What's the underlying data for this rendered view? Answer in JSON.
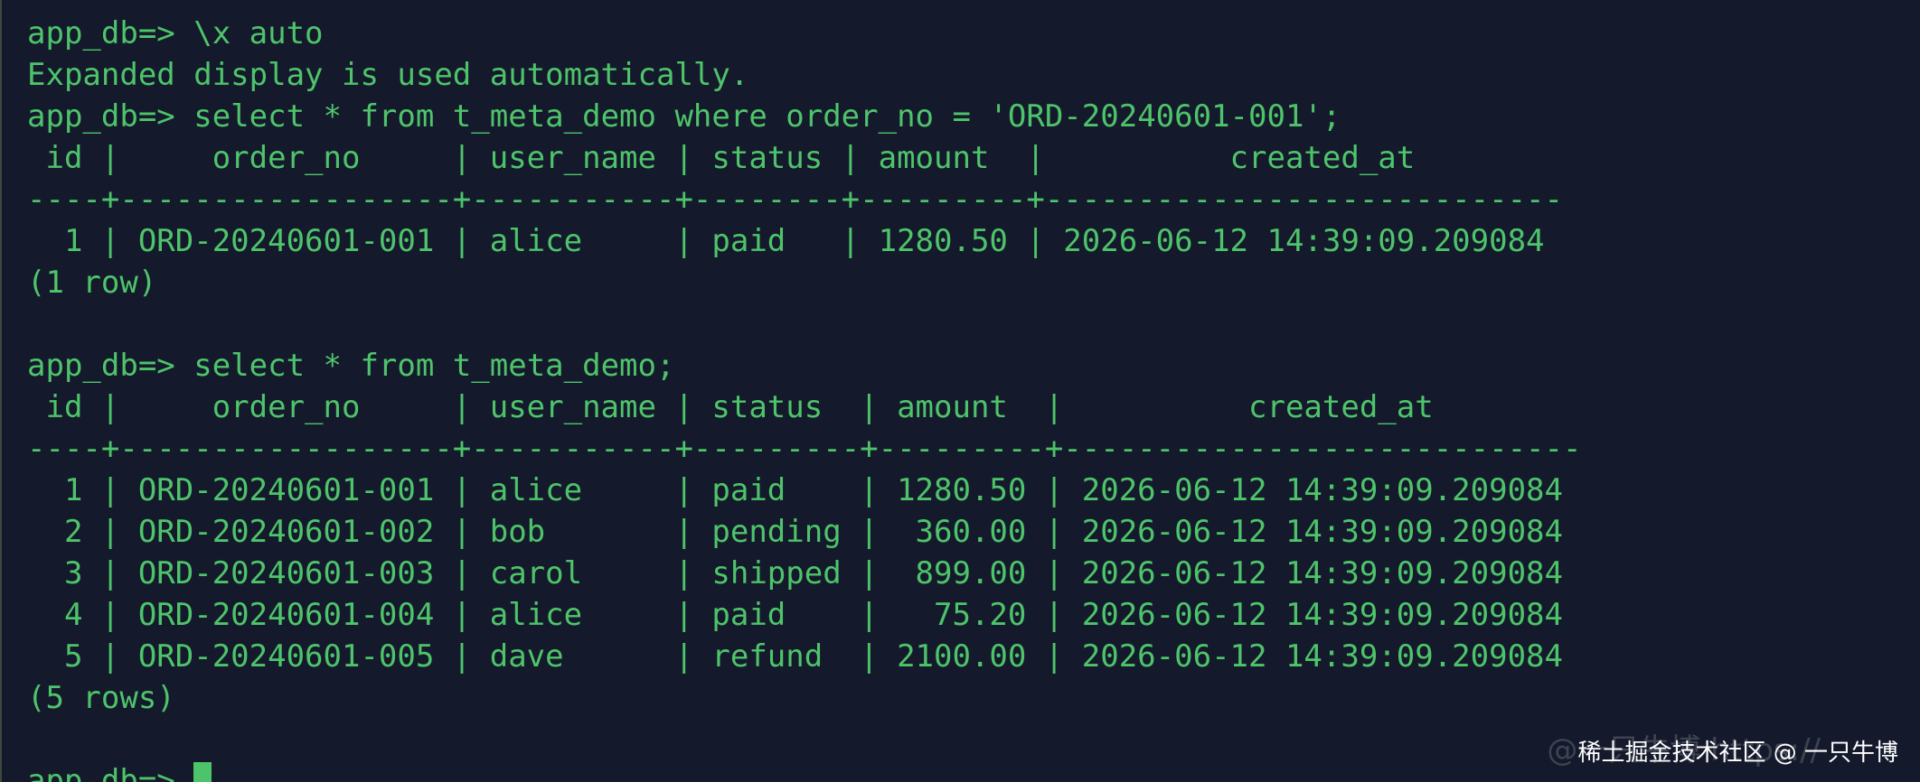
{
  "terminal": {
    "prompt": "app_db=> ",
    "lines": [
      {
        "kind": "input",
        "prompt": "app_db=> ",
        "text": "\\x auto"
      },
      {
        "kind": "output",
        "text": "Expanded display is used automatically."
      },
      {
        "kind": "input",
        "prompt": "app_db=> ",
        "text": "select * from t_meta_demo where order_no = 'ORD-20240601-001';"
      },
      {
        "kind": "table-header",
        "text": " id |     order_no     | user_name | status | amount  |          created_at"
      },
      {
        "kind": "table-separator",
        "text": "----+------------------+-----------+--------+---------+----------------------------"
      },
      {
        "kind": "table-row",
        "text": "  1 | ORD-20240601-001 | alice     | paid   | 1280.50 | 2026-06-12 14:39:09.209084"
      },
      {
        "kind": "output",
        "text": "(1 row)"
      },
      {
        "kind": "blank",
        "text": ""
      },
      {
        "kind": "input",
        "prompt": "app_db=> ",
        "text": "select * from t_meta_demo;"
      },
      {
        "kind": "table-header",
        "text": " id |     order_no     | user_name | status  | amount  |          created_at"
      },
      {
        "kind": "table-separator",
        "text": "----+------------------+-----------+---------+---------+----------------------------"
      },
      {
        "kind": "table-row",
        "text": "  1 | ORD-20240601-001 | alice     | paid    | 1280.50 | 2026-06-12 14:39:09.209084"
      },
      {
        "kind": "table-row",
        "text": "  2 | ORD-20240601-002 | bob       | pending |  360.00 | 2026-06-12 14:39:09.209084"
      },
      {
        "kind": "table-row",
        "text": "  3 | ORD-20240601-003 | carol     | shipped |  899.00 | 2026-06-12 14:39:09.209084"
      },
      {
        "kind": "table-row",
        "text": "  4 | ORD-20240601-004 | alice     | paid    |   75.20 | 2026-06-12 14:39:09.209084"
      },
      {
        "kind": "table-row",
        "text": "  5 | ORD-20240601-005 | dave      | refund  | 2100.00 | 2026-06-12 14:39:09.209084"
      },
      {
        "kind": "output",
        "text": "(5 rows)"
      },
      {
        "kind": "blank",
        "text": ""
      }
    ],
    "current_prompt": "app_db=> "
  },
  "colors": {
    "background": "#141a2c",
    "text": "#4ec46a"
  },
  "watermark": {
    "text": "稀土掘金技术社区 @ 一只牛博",
    "shadow_text": "@一只牛博 https://"
  }
}
